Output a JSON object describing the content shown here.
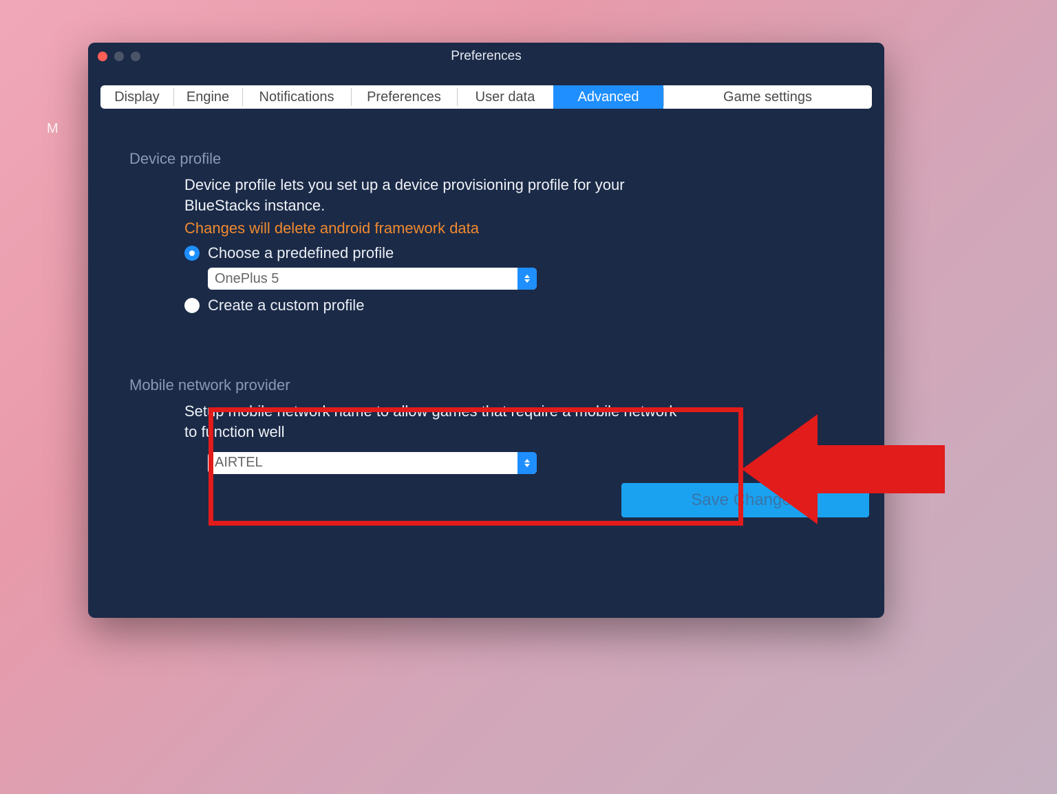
{
  "bg_letter": "M",
  "window": {
    "title": "Preferences"
  },
  "tabs": {
    "display": "Display",
    "engine": "Engine",
    "notifications": "Notifications",
    "preferences": "Preferences",
    "userdata": "User data",
    "advanced": "Advanced",
    "gamesettings": "Game settings"
  },
  "device_profile": {
    "title": "Device profile",
    "desc": "Device profile lets you set up a device provisioning profile for your BlueStacks instance.",
    "warning": "Changes will delete android framework data",
    "radio_predefined": "Choose a predefined profile",
    "predefined_value": "OnePlus 5",
    "radio_custom": "Create a custom profile"
  },
  "mobile_network": {
    "title": "Mobile network provider",
    "desc": "Setup mobile network name to allow games that require a mobile network to function well",
    "value": "AIRTEL"
  },
  "save_button": "Save Changes"
}
